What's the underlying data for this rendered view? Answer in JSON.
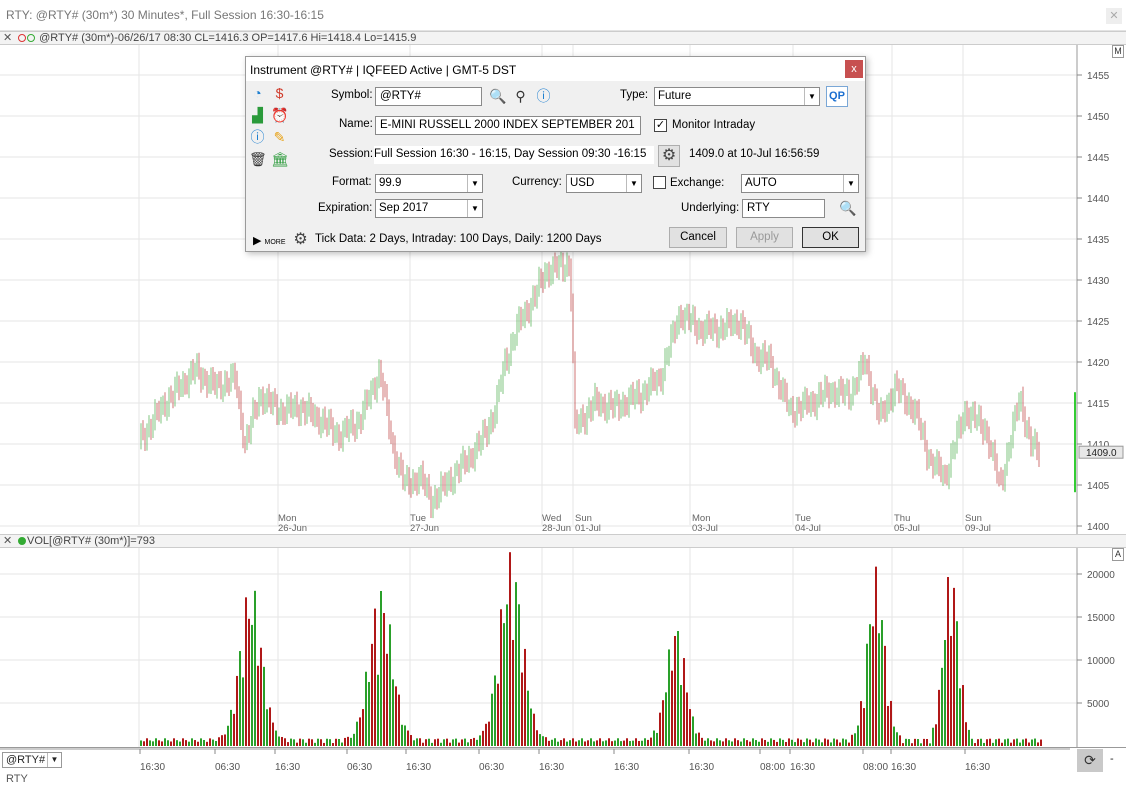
{
  "window": {
    "title": "RTY: @RTY# (30m*) 30 Minutes*, Full Session 16:30-16:15",
    "close_glyph": "✕"
  },
  "price_pane": {
    "close_glyph": "✕",
    "header_text": "@RTY# (30m*)-06/26/17 08:30 CL=1416.3 OP=1417.6 Hi=1418.4 Lo=1415.9",
    "scale_btn": "M",
    "y_ticks": [
      "1455",
      "1450",
      "1445",
      "1440",
      "1435",
      "1430",
      "1425",
      "1420",
      "1415",
      "1410",
      "1405",
      "1400"
    ],
    "last_price": "1409.0",
    "date_labels": [
      {
        "day": "Mon",
        "date": "26-Jun"
      },
      {
        "day": "Tue",
        "date": "27-Jun"
      },
      {
        "day": "Wed",
        "date": "28-Jun"
      },
      {
        "day": "Sun",
        "date": "01-Jul"
      },
      {
        "day": "Mon",
        "date": "03-Jul"
      },
      {
        "day": "Tue",
        "date": "04-Jul"
      },
      {
        "day": "Thu",
        "date": "05-Jul"
      },
      {
        "day": "Sun",
        "date": "09-Jul"
      }
    ]
  },
  "volume_pane": {
    "close_glyph": "✕",
    "header_text": "VOL[@RTY# (30m*)]=793",
    "scale_btn": "A",
    "y_ticks": [
      "20000",
      "15000",
      "10000",
      "5000"
    ]
  },
  "time_axis": [
    "16:30",
    "06:30",
    "16:30",
    "06:30",
    "16:30",
    "06:30",
    "16:30",
    "16:30",
    "16:30",
    "08:00",
    "16:30",
    "08:00",
    "16:30",
    "16:30"
  ],
  "bottombar": {
    "symbol": "@RTY#",
    "refresh_glyph": "⟳",
    "minus": "-"
  },
  "statusbar": {
    "text": "RTY"
  },
  "dialog": {
    "title": "Instrument @RTY# | IQFEED Active | GMT-5  DST",
    "close_glyph": "x",
    "symbol_label": "Symbol:",
    "symbol_value": "@RTY#",
    "type_label": "Type:",
    "type_value": "Future",
    "qp_label": "QP",
    "name_label": "Name:",
    "name_value": "E-MINI RUSSELL 2000 INDEX SEPTEMBER 201",
    "monitor_label": "Monitor Intraday",
    "monitor_checked": "✓",
    "session_label": "Session:",
    "session_value": "Full Session 16:30 - 16:15, Day Session 09:30 -16:15",
    "last_trade": "1409.0 at 10-Jul 16:56:59",
    "format_label": "Format:",
    "format_value": "99.9",
    "currency_label": "Currency:",
    "currency_value": "USD",
    "exchange_label": "Exchange:",
    "exchange_value": "AUTO",
    "expiration_label": "Expiration:",
    "expiration_value": "Sep 2017",
    "underlying_label": "Underlying:",
    "underlying_value": "RTY",
    "more_label": "MORE",
    "tick_info": "Tick Data: 2 Days, Intraday: 100 Days, Daily: 1200 Days",
    "cancel_label": "Cancel",
    "apply_label": "Apply",
    "ok_label": "OK"
  },
  "colors": {
    "up": "#2aa02a",
    "down": "#b01818",
    "grid": "#e6e6e6",
    "last_price_bg": "#e8e8e8",
    "dialog_bg": "#f0f0f0",
    "close_red": "#c75050"
  }
}
